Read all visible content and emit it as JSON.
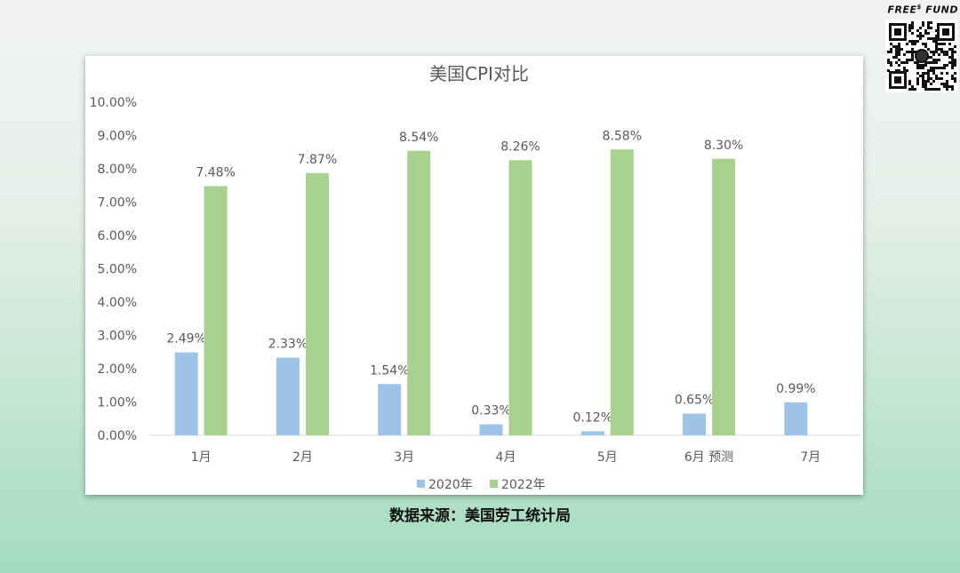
{
  "brand": {
    "name": "FREE",
    "superscript": "$",
    "suffix": "FUND",
    "qr_icon": "qr-code-icon"
  },
  "colors": {
    "series_2020": "#9dc3e6",
    "series_2022": "#a9d18e",
    "axis": "#d9d9d9",
    "text": "#595959"
  },
  "chart_data": {
    "type": "bar",
    "title": "美国CPI对比",
    "categories": [
      "1月",
      "2月",
      "3月",
      "4月",
      "5月",
      "6月 预测",
      "7月"
    ],
    "series": [
      {
        "name": "2020年",
        "values": [
          2.49,
          2.33,
          1.54,
          0.33,
          0.12,
          0.65,
          0.99
        ],
        "labels": [
          "2.49%",
          "2.33%",
          "1.54%",
          "0.33%",
          "0.12%",
          "0.65%",
          "0.99%"
        ]
      },
      {
        "name": "2022年",
        "values": [
          7.48,
          7.87,
          8.54,
          8.26,
          8.58,
          8.3,
          null
        ],
        "labels": [
          "7.48%",
          "7.87%",
          "8.54%",
          "8.26%",
          "8.58%",
          "8.30%",
          null
        ]
      }
    ],
    "ylim": [
      0,
      10
    ],
    "yticks": [
      "0.00%",
      "1.00%",
      "2.00%",
      "3.00%",
      "4.00%",
      "5.00%",
      "6.00%",
      "7.00%",
      "8.00%",
      "9.00%",
      "10.00%"
    ],
    "ytick_values": [
      0,
      1,
      2,
      3,
      4,
      5,
      6,
      7,
      8,
      9,
      10
    ],
    "legend_position": "bottom",
    "grid": false
  },
  "source": "数据来源：美国劳工统计局"
}
